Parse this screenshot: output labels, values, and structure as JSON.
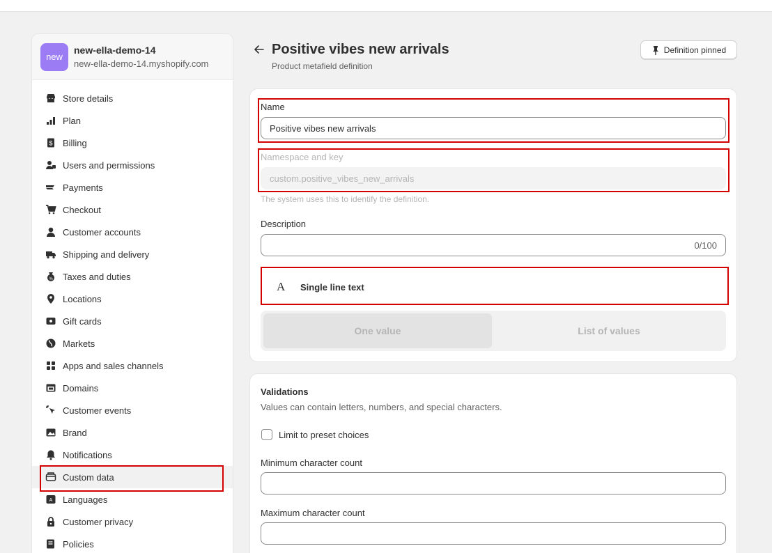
{
  "store": {
    "avatar_text": "new",
    "name": "new-ella-demo-14",
    "url": "new-ella-demo-14.myshopify.com"
  },
  "sidebar": {
    "items": [
      {
        "label": "Store details",
        "icon": "store-icon"
      },
      {
        "label": "Plan",
        "icon": "plan-icon"
      },
      {
        "label": "Billing",
        "icon": "billing-icon"
      },
      {
        "label": "Users and permissions",
        "icon": "users-icon"
      },
      {
        "label": "Payments",
        "icon": "payments-icon"
      },
      {
        "label": "Checkout",
        "icon": "cart-icon"
      },
      {
        "label": "Customer accounts",
        "icon": "person-icon"
      },
      {
        "label": "Shipping and delivery",
        "icon": "truck-icon"
      },
      {
        "label": "Taxes and duties",
        "icon": "taxes-icon"
      },
      {
        "label": "Locations",
        "icon": "location-icon"
      },
      {
        "label": "Gift cards",
        "icon": "gift-card-icon"
      },
      {
        "label": "Markets",
        "icon": "globe-icon"
      },
      {
        "label": "Apps and sales channels",
        "icon": "apps-icon"
      },
      {
        "label": "Domains",
        "icon": "domains-icon"
      },
      {
        "label": "Customer events",
        "icon": "cursor-icon"
      },
      {
        "label": "Brand",
        "icon": "brand-icon"
      },
      {
        "label": "Notifications",
        "icon": "bell-icon"
      },
      {
        "label": "Custom data",
        "icon": "custom-data-icon"
      },
      {
        "label": "Languages",
        "icon": "languages-icon"
      },
      {
        "label": "Customer privacy",
        "icon": "lock-icon"
      },
      {
        "label": "Policies",
        "icon": "policies-icon"
      }
    ],
    "active_index": 17
  },
  "header": {
    "title": "Positive vibes new arrivals",
    "subtitle": "Product metafield definition",
    "pin_label": "Definition pinned"
  },
  "definition": {
    "name_label": "Name",
    "name_value": "Positive vibes new arrivals",
    "namespace_label": "Namespace and key",
    "namespace_value": "custom.positive_vibes_new_arrivals",
    "namespace_help": "The system uses this to identify the definition.",
    "description_label": "Description",
    "description_value": "",
    "description_counter": "0/100",
    "type_icon": "A",
    "type_label": "Single line text",
    "value_options": [
      "One value",
      "List of values"
    ],
    "selected_option": "One value"
  },
  "validations": {
    "title": "Validations",
    "description": "Values can contain letters, numbers, and special characters.",
    "preset_label": "Limit to preset choices",
    "preset_checked": false,
    "min_label": "Minimum character count",
    "min_value": "",
    "max_label": "Maximum character count",
    "max_value": ""
  },
  "colors": {
    "highlight": "#d40000",
    "avatar": "#9b7cf5"
  }
}
